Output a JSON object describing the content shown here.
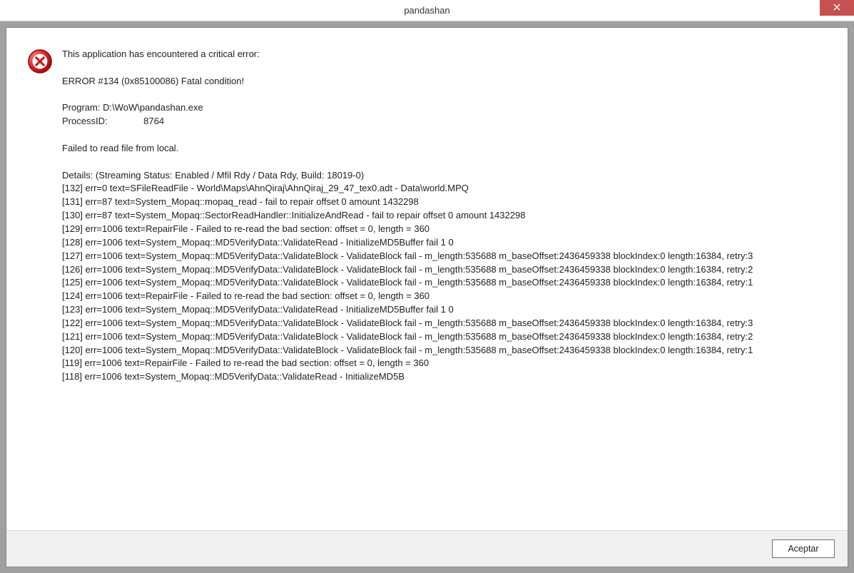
{
  "window": {
    "title": "pandashan"
  },
  "error": {
    "header": "This application has encountered a critical error:",
    "code_line": "ERROR #134 (0x85100086) Fatal condition!",
    "program_line": "Program: D:\\WoW\\pandashan.exe",
    "process_line": "ProcessID:              8764",
    "fail_line": "Failed to read file from local.",
    "details_line": "Details: (Streaming Status: Enabled / Mfil Rdy / Data Rdy, Build: 18019-0)",
    "log_lines": [
      "[132] err=0 text=SFileReadFile - World\\Maps\\AhnQiraj\\AhnQiraj_29_47_tex0.adt - Data\\world.MPQ",
      "[131] err=87 text=System_Mopaq::mopaq_read - fail to repair offset 0 amount 1432298",
      "[130] err=87 text=System_Mopaq::SectorReadHandler::InitializeAndRead - fail to repair offset 0 amount 1432298",
      "[129] err=1006 text=RepairFile - Failed to re-read the bad section: offset = 0, length = 360",
      "[128] err=1006 text=System_Mopaq::MD5VerifyData::ValidateRead - InitializeMD5Buffer fail 1 0",
      "[127] err=1006 text=System_Mopaq::MD5VerifyData::ValidateBlock - ValidateBlock fail - m_length:535688 m_baseOffset:2436459338 blockIndex:0 length:16384, retry:3",
      "[126] err=1006 text=System_Mopaq::MD5VerifyData::ValidateBlock - ValidateBlock fail - m_length:535688 m_baseOffset:2436459338 blockIndex:0 length:16384, retry:2",
      "[125] err=1006 text=System_Mopaq::MD5VerifyData::ValidateBlock - ValidateBlock fail - m_length:535688 m_baseOffset:2436459338 blockIndex:0 length:16384, retry:1",
      "[124] err=1006 text=RepairFile - Failed to re-read the bad section: offset = 0, length = 360",
      "[123] err=1006 text=System_Mopaq::MD5VerifyData::ValidateRead - InitializeMD5Buffer fail 1 0",
      "[122] err=1006 text=System_Mopaq::MD5VerifyData::ValidateBlock - ValidateBlock fail - m_length:535688 m_baseOffset:2436459338 blockIndex:0 length:16384, retry:3",
      "[121] err=1006 text=System_Mopaq::MD5VerifyData::ValidateBlock - ValidateBlock fail - m_length:535688 m_baseOffset:2436459338 blockIndex:0 length:16384, retry:2",
      "[120] err=1006 text=System_Mopaq::MD5VerifyData::ValidateBlock - ValidateBlock fail - m_length:535688 m_baseOffset:2436459338 blockIndex:0 length:16384, retry:1",
      "[119] err=1006 text=RepairFile - Failed to re-read the bad section: offset = 0, length = 360",
      "[118] err=1006 text=System_Mopaq::MD5VerifyData::ValidateRead - InitializeMD5B"
    ]
  },
  "buttons": {
    "accept": "Aceptar"
  }
}
